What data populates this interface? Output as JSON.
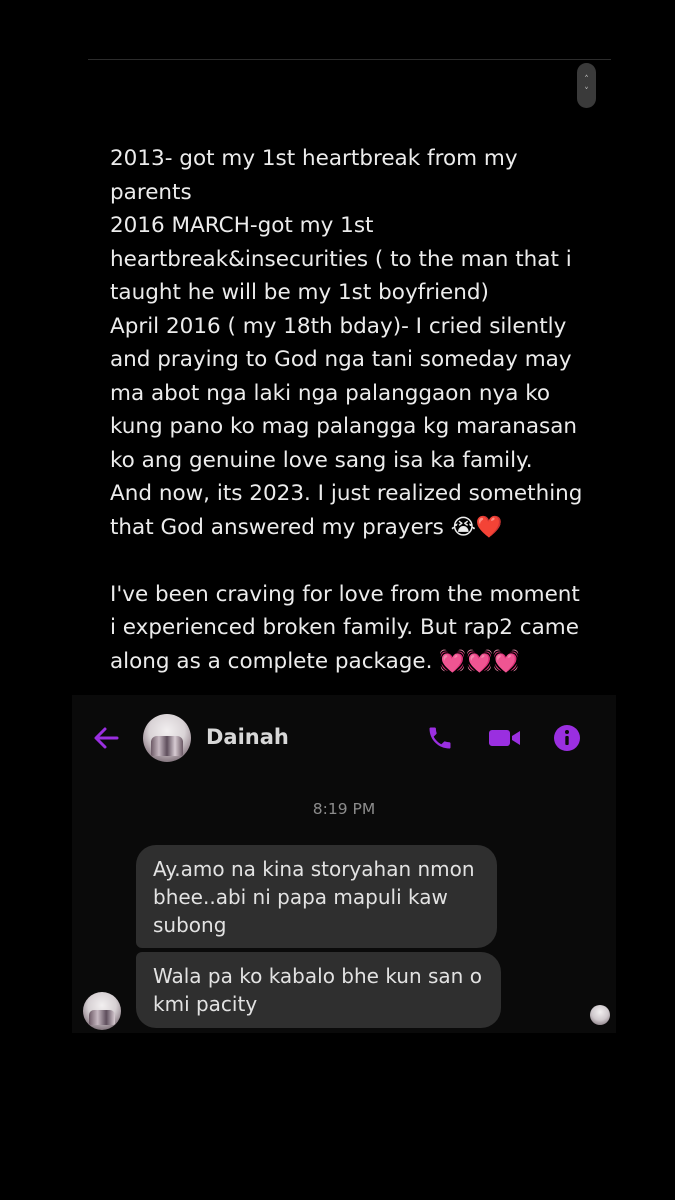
{
  "note": {
    "lines": [
      "2013- got my 1st heartbreak from my",
      "parents",
      "2016 MARCH-got my 1st",
      "heartbreak&insecurities ( to the man that i",
      "taught he will be my 1st boyfriend)",
      "April 2016 ( my 18th bday)- I cried silently",
      "and praying to God nga tani someday may",
      "ma abot nga laki nga palanggaon nya ko",
      "kung pano ko mag palangga kg maranasan",
      "ko ang genuine love sang isa ka family.",
      "And now, its 2023. I just realized something",
      "that God answered my prayers"
    ],
    "line12_emojis": "😭❤️",
    "para2_lines": [
      "I've been craving for love from the moment",
      "i experienced broken family. But rap2 came",
      "along as a complete package."
    ],
    "para2_emojis": "💓💓💓"
  },
  "chat": {
    "contact_name": "Dainah",
    "timestamp": "8:19 PM",
    "messages": [
      {
        "lines": [
          "Ay.amo na kina storyahan nmon",
          "bhee..abi ni papa mapuli kaw",
          "subong"
        ]
      },
      {
        "lines": [
          "Wala pa ko kabalo bhe kun san o",
          "kmi pacity"
        ]
      }
    ],
    "accent_color": "#9a2fe0",
    "icons": [
      "back-arrow-icon",
      "phone-icon",
      "video-call-icon",
      "info-icon"
    ]
  }
}
